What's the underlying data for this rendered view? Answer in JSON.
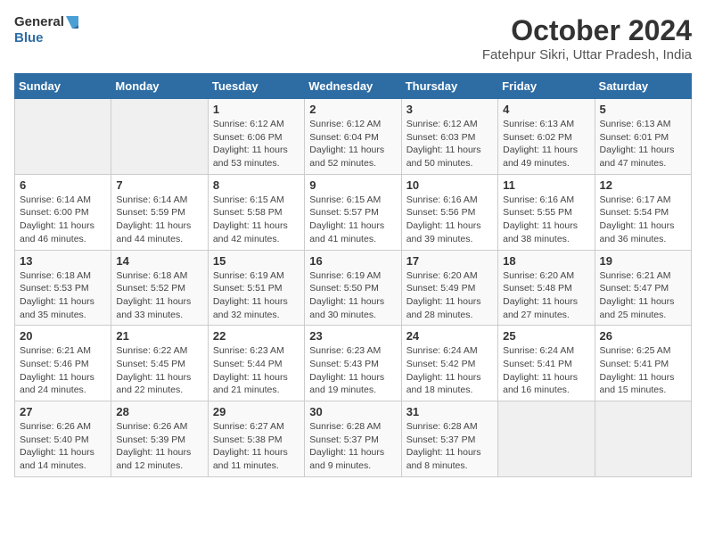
{
  "header": {
    "logo_line1": "General",
    "logo_line2": "Blue",
    "month_title": "October 2024",
    "subtitle": "Fatehpur Sikri, Uttar Pradesh, India"
  },
  "weekdays": [
    "Sunday",
    "Monday",
    "Tuesday",
    "Wednesday",
    "Thursday",
    "Friday",
    "Saturday"
  ],
  "weeks": [
    [
      {
        "day": "",
        "content": ""
      },
      {
        "day": "",
        "content": ""
      },
      {
        "day": "1",
        "sunrise": "Sunrise: 6:12 AM",
        "sunset": "Sunset: 6:06 PM",
        "daylight": "Daylight: 11 hours and 53 minutes."
      },
      {
        "day": "2",
        "sunrise": "Sunrise: 6:12 AM",
        "sunset": "Sunset: 6:04 PM",
        "daylight": "Daylight: 11 hours and 52 minutes."
      },
      {
        "day": "3",
        "sunrise": "Sunrise: 6:12 AM",
        "sunset": "Sunset: 6:03 PM",
        "daylight": "Daylight: 11 hours and 50 minutes."
      },
      {
        "day": "4",
        "sunrise": "Sunrise: 6:13 AM",
        "sunset": "Sunset: 6:02 PM",
        "daylight": "Daylight: 11 hours and 49 minutes."
      },
      {
        "day": "5",
        "sunrise": "Sunrise: 6:13 AM",
        "sunset": "Sunset: 6:01 PM",
        "daylight": "Daylight: 11 hours and 47 minutes."
      }
    ],
    [
      {
        "day": "6",
        "sunrise": "Sunrise: 6:14 AM",
        "sunset": "Sunset: 6:00 PM",
        "daylight": "Daylight: 11 hours and 46 minutes."
      },
      {
        "day": "7",
        "sunrise": "Sunrise: 6:14 AM",
        "sunset": "Sunset: 5:59 PM",
        "daylight": "Daylight: 11 hours and 44 minutes."
      },
      {
        "day": "8",
        "sunrise": "Sunrise: 6:15 AM",
        "sunset": "Sunset: 5:58 PM",
        "daylight": "Daylight: 11 hours and 42 minutes."
      },
      {
        "day": "9",
        "sunrise": "Sunrise: 6:15 AM",
        "sunset": "Sunset: 5:57 PM",
        "daylight": "Daylight: 11 hours and 41 minutes."
      },
      {
        "day": "10",
        "sunrise": "Sunrise: 6:16 AM",
        "sunset": "Sunset: 5:56 PM",
        "daylight": "Daylight: 11 hours and 39 minutes."
      },
      {
        "day": "11",
        "sunrise": "Sunrise: 6:16 AM",
        "sunset": "Sunset: 5:55 PM",
        "daylight": "Daylight: 11 hours and 38 minutes."
      },
      {
        "day": "12",
        "sunrise": "Sunrise: 6:17 AM",
        "sunset": "Sunset: 5:54 PM",
        "daylight": "Daylight: 11 hours and 36 minutes."
      }
    ],
    [
      {
        "day": "13",
        "sunrise": "Sunrise: 6:18 AM",
        "sunset": "Sunset: 5:53 PM",
        "daylight": "Daylight: 11 hours and 35 minutes."
      },
      {
        "day": "14",
        "sunrise": "Sunrise: 6:18 AM",
        "sunset": "Sunset: 5:52 PM",
        "daylight": "Daylight: 11 hours and 33 minutes."
      },
      {
        "day": "15",
        "sunrise": "Sunrise: 6:19 AM",
        "sunset": "Sunset: 5:51 PM",
        "daylight": "Daylight: 11 hours and 32 minutes."
      },
      {
        "day": "16",
        "sunrise": "Sunrise: 6:19 AM",
        "sunset": "Sunset: 5:50 PM",
        "daylight": "Daylight: 11 hours and 30 minutes."
      },
      {
        "day": "17",
        "sunrise": "Sunrise: 6:20 AM",
        "sunset": "Sunset: 5:49 PM",
        "daylight": "Daylight: 11 hours and 28 minutes."
      },
      {
        "day": "18",
        "sunrise": "Sunrise: 6:20 AM",
        "sunset": "Sunset: 5:48 PM",
        "daylight": "Daylight: 11 hours and 27 minutes."
      },
      {
        "day": "19",
        "sunrise": "Sunrise: 6:21 AM",
        "sunset": "Sunset: 5:47 PM",
        "daylight": "Daylight: 11 hours and 25 minutes."
      }
    ],
    [
      {
        "day": "20",
        "sunrise": "Sunrise: 6:21 AM",
        "sunset": "Sunset: 5:46 PM",
        "daylight": "Daylight: 11 hours and 24 minutes."
      },
      {
        "day": "21",
        "sunrise": "Sunrise: 6:22 AM",
        "sunset": "Sunset: 5:45 PM",
        "daylight": "Daylight: 11 hours and 22 minutes."
      },
      {
        "day": "22",
        "sunrise": "Sunrise: 6:23 AM",
        "sunset": "Sunset: 5:44 PM",
        "daylight": "Daylight: 11 hours and 21 minutes."
      },
      {
        "day": "23",
        "sunrise": "Sunrise: 6:23 AM",
        "sunset": "Sunset: 5:43 PM",
        "daylight": "Daylight: 11 hours and 19 minutes."
      },
      {
        "day": "24",
        "sunrise": "Sunrise: 6:24 AM",
        "sunset": "Sunset: 5:42 PM",
        "daylight": "Daylight: 11 hours and 18 minutes."
      },
      {
        "day": "25",
        "sunrise": "Sunrise: 6:24 AM",
        "sunset": "Sunset: 5:41 PM",
        "daylight": "Daylight: 11 hours and 16 minutes."
      },
      {
        "day": "26",
        "sunrise": "Sunrise: 6:25 AM",
        "sunset": "Sunset: 5:41 PM",
        "daylight": "Daylight: 11 hours and 15 minutes."
      }
    ],
    [
      {
        "day": "27",
        "sunrise": "Sunrise: 6:26 AM",
        "sunset": "Sunset: 5:40 PM",
        "daylight": "Daylight: 11 hours and 14 minutes."
      },
      {
        "day": "28",
        "sunrise": "Sunrise: 6:26 AM",
        "sunset": "Sunset: 5:39 PM",
        "daylight": "Daylight: 11 hours and 12 minutes."
      },
      {
        "day": "29",
        "sunrise": "Sunrise: 6:27 AM",
        "sunset": "Sunset: 5:38 PM",
        "daylight": "Daylight: 11 hours and 11 minutes."
      },
      {
        "day": "30",
        "sunrise": "Sunrise: 6:28 AM",
        "sunset": "Sunset: 5:37 PM",
        "daylight": "Daylight: 11 hours and 9 minutes."
      },
      {
        "day": "31",
        "sunrise": "Sunrise: 6:28 AM",
        "sunset": "Sunset: 5:37 PM",
        "daylight": "Daylight: 11 hours and 8 minutes."
      },
      {
        "day": "",
        "content": ""
      },
      {
        "day": "",
        "content": ""
      }
    ]
  ]
}
